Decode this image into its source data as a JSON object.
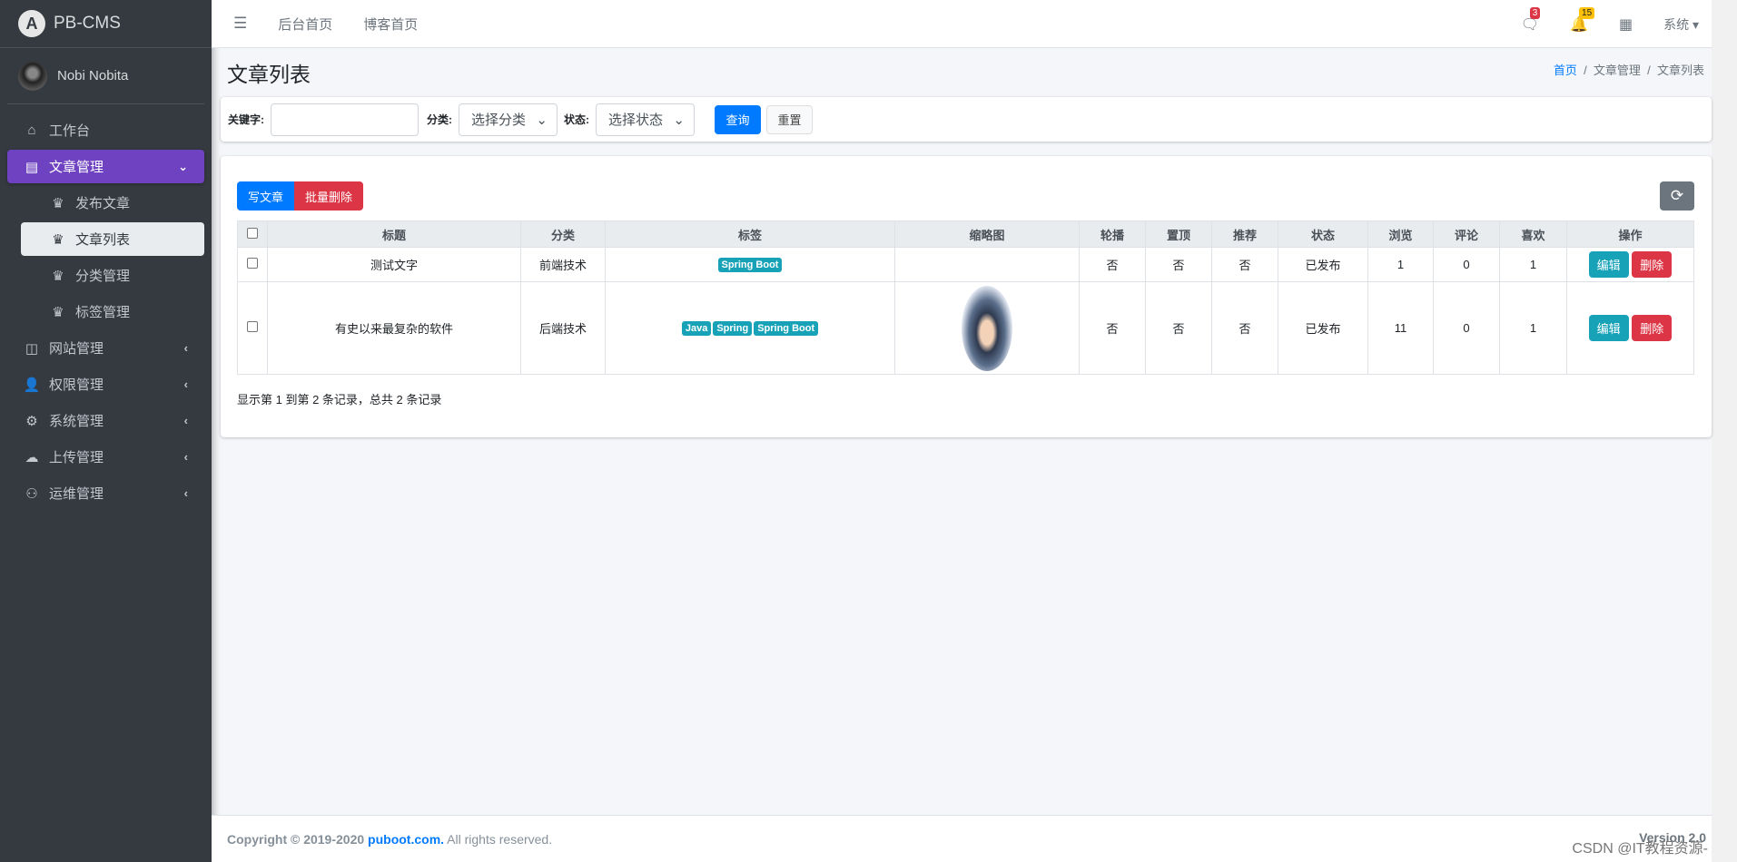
{
  "brand": {
    "name": "PB-CMS",
    "logo": "A"
  },
  "user": {
    "name": "Nobi Nobita"
  },
  "sidebar": {
    "items": [
      {
        "label": "工作台",
        "icon": "home-icon"
      },
      {
        "label": "文章管理",
        "icon": "newspaper-icon",
        "active": true
      },
      {
        "label": "发布文章",
        "icon": "chess-queen-icon"
      },
      {
        "label": "文章列表",
        "icon": "chess-queen-icon",
        "current": true
      },
      {
        "label": "分类管理",
        "icon": "chess-queen-icon"
      },
      {
        "label": "标签管理",
        "icon": "chess-queen-icon"
      },
      {
        "label": "网站管理",
        "icon": "columns-icon"
      },
      {
        "label": "权限管理",
        "icon": "user-cog-icon"
      },
      {
        "label": "系统管理",
        "icon": "gear-icon"
      },
      {
        "label": "上传管理",
        "icon": "cloud-upload-icon"
      },
      {
        "label": "运维管理",
        "icon": "people-carry-icon"
      }
    ]
  },
  "topbar": {
    "links": [
      "后台首页",
      "博客首页"
    ],
    "messages_count": "3",
    "notifications_count": "15",
    "system_label": "系统"
  },
  "page": {
    "title": "文章列表",
    "breadcrumb": [
      "首页",
      "文章管理",
      "文章列表"
    ]
  },
  "filter": {
    "keyword_label": "关键字:",
    "keyword_value": "",
    "category_label": "分类:",
    "category_value": "选择分类",
    "status_label": "状态:",
    "status_value": "选择状态",
    "search": "查询",
    "reset": "重置"
  },
  "toolbar": {
    "write": "写文章",
    "batch_delete": "批量删除"
  },
  "table": {
    "headers": [
      "标题",
      "分类",
      "标签",
      "缩略图",
      "轮播",
      "置顶",
      "推荐",
      "状态",
      "浏览",
      "评论",
      "喜欢",
      "操作"
    ],
    "rows": [
      {
        "title": "测试文字",
        "category": "前端技术",
        "tags": [
          "Spring Boot"
        ],
        "thumbnail": false,
        "carousel": "否",
        "top": "否",
        "recommend": "否",
        "status": "已发布",
        "views": "1",
        "comments": "0",
        "likes": "1"
      },
      {
        "title": "有史以来最复杂的软件",
        "category": "后端技术",
        "tags": [
          "Java",
          "Spring",
          "Spring Boot"
        ],
        "thumbnail": true,
        "carousel": "否",
        "top": "否",
        "recommend": "否",
        "status": "已发布",
        "views": "11",
        "comments": "0",
        "likes": "1"
      }
    ],
    "edit": "编辑",
    "delete": "删除",
    "summary": "显示第 1 到第 2 条记录，总共 2 条记录"
  },
  "footer": {
    "copyright": "Copyright © 2019-2020",
    "site": "puboot.com.",
    "rights": "All rights reserved.",
    "version": "Version 2.0",
    "watermark": "CSDN @IT教程资源-"
  },
  "colors": {
    "sidebar": "#343a40",
    "active": "#6f42c1",
    "primary": "#007bff",
    "danger": "#dc3545",
    "info": "#17a2b8",
    "secondary": "#6c757d"
  }
}
